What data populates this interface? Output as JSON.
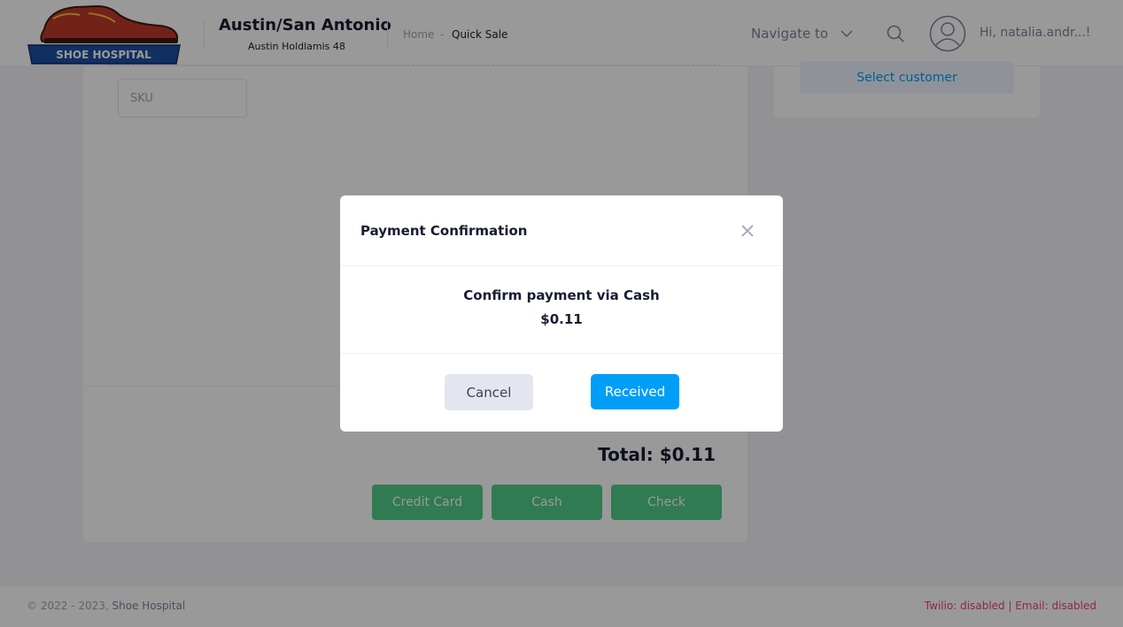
{
  "header": {
    "logo_text": "SHOE HOSPITAL",
    "store_name": "Austin/San Antonio",
    "store_sub": "Austin Holdlamis 48",
    "breadcrumb": {
      "home": "Home",
      "separator": "-",
      "current": "Quick Sale"
    },
    "navigate_label": "Navigate to",
    "greeting": "Hi, natalia.andr...!"
  },
  "main": {
    "sku_placeholder": "SKU",
    "total_label": "Total: $0.11",
    "payment_buttons": [
      "Credit Card",
      "Cash",
      "Check"
    ]
  },
  "sidebar": {
    "select_customer_label": "Select customer"
  },
  "footer": {
    "copyright": "© 2022 - 2023,",
    "brand": "Shoe Hospital",
    "status": "Twilio: disabled | Email: disabled"
  },
  "modal": {
    "title": "Payment Confirmation",
    "message": "Confirm payment via Cash",
    "amount": "$0.11",
    "cancel_label": "Cancel",
    "confirm_label": "Received"
  },
  "colors": {
    "primary": "#009ef7",
    "success": "#50cd89",
    "danger": "#f1416c",
    "muted": "#a1a5b7",
    "logo_red": "#c0392b",
    "logo_blue": "#1f4fa3"
  },
  "icons": {
    "close": "close-icon",
    "search": "search-icon",
    "chevron": "chevron-down-icon",
    "user": "user-avatar-icon"
  }
}
